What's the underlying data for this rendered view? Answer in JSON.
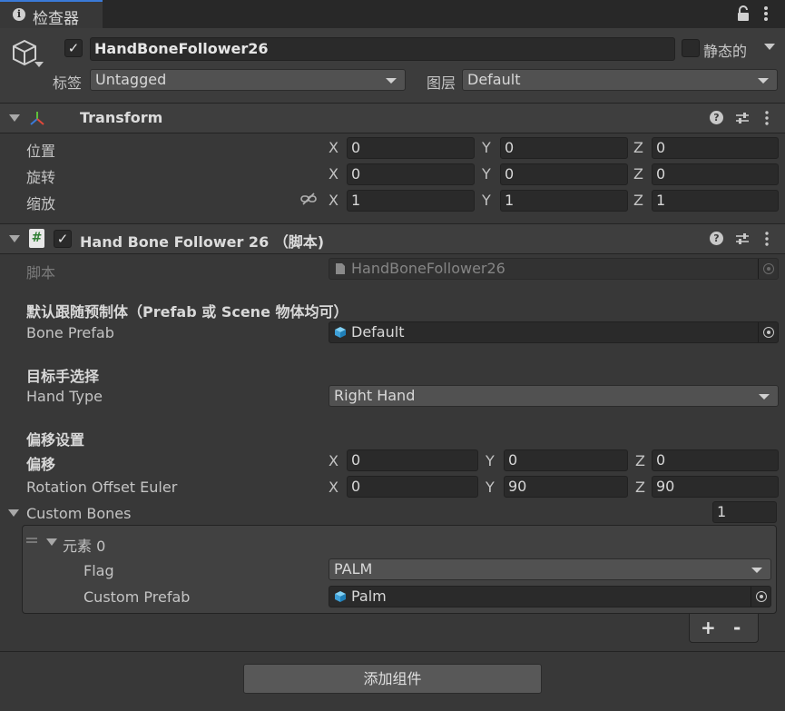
{
  "tab": {
    "title": "检查器",
    "info_icon": "info-icon"
  },
  "header": {
    "object_name": "HandBoneFollower26",
    "static_label": "静态的",
    "tag_label": "标签",
    "tag_value": "Untagged",
    "layer_label": "图层",
    "layer_value": "Default"
  },
  "transform": {
    "title": "Transform",
    "position": {
      "label": "位置",
      "x": "0",
      "y": "0",
      "z": "0"
    },
    "rotation": {
      "label": "旋转",
      "x": "0",
      "y": "0",
      "z": "0"
    },
    "scale": {
      "label": "缩放",
      "x": "1",
      "y": "1",
      "z": "1"
    },
    "axes": {
      "x": "X",
      "y": "Y",
      "z": "Z"
    }
  },
  "script": {
    "title": "Hand Bone Follower 26 （脚本)",
    "script_label": "脚本",
    "script_value": "HandBoneFollower26",
    "section_default": "默认跟随预制体（Prefab 或 Scene 物体均可）",
    "bone_prefab_label": "Bone Prefab",
    "bone_prefab_value": "Default",
    "section_hand": "目标手选择",
    "hand_type_label": "Hand Type",
    "hand_type_value": "Right Hand",
    "section_offset": "偏移设置",
    "offset_label": "偏移",
    "offset": {
      "x": "0",
      "y": "0",
      "z": "0"
    },
    "rot_offset_label": "Rotation Offset Euler",
    "rot_offset": {
      "x": "0",
      "y": "90",
      "z": "90"
    },
    "custom_bones_label": "Custom Bones",
    "custom_bones_count": "1",
    "element_label": "元素 0",
    "flag_label": "Flag",
    "flag_value": "PALM",
    "custom_prefab_label": "Custom Prefab",
    "custom_prefab_value": "Palm",
    "plus": "+",
    "minus": "-"
  },
  "add_component": "添加组件"
}
